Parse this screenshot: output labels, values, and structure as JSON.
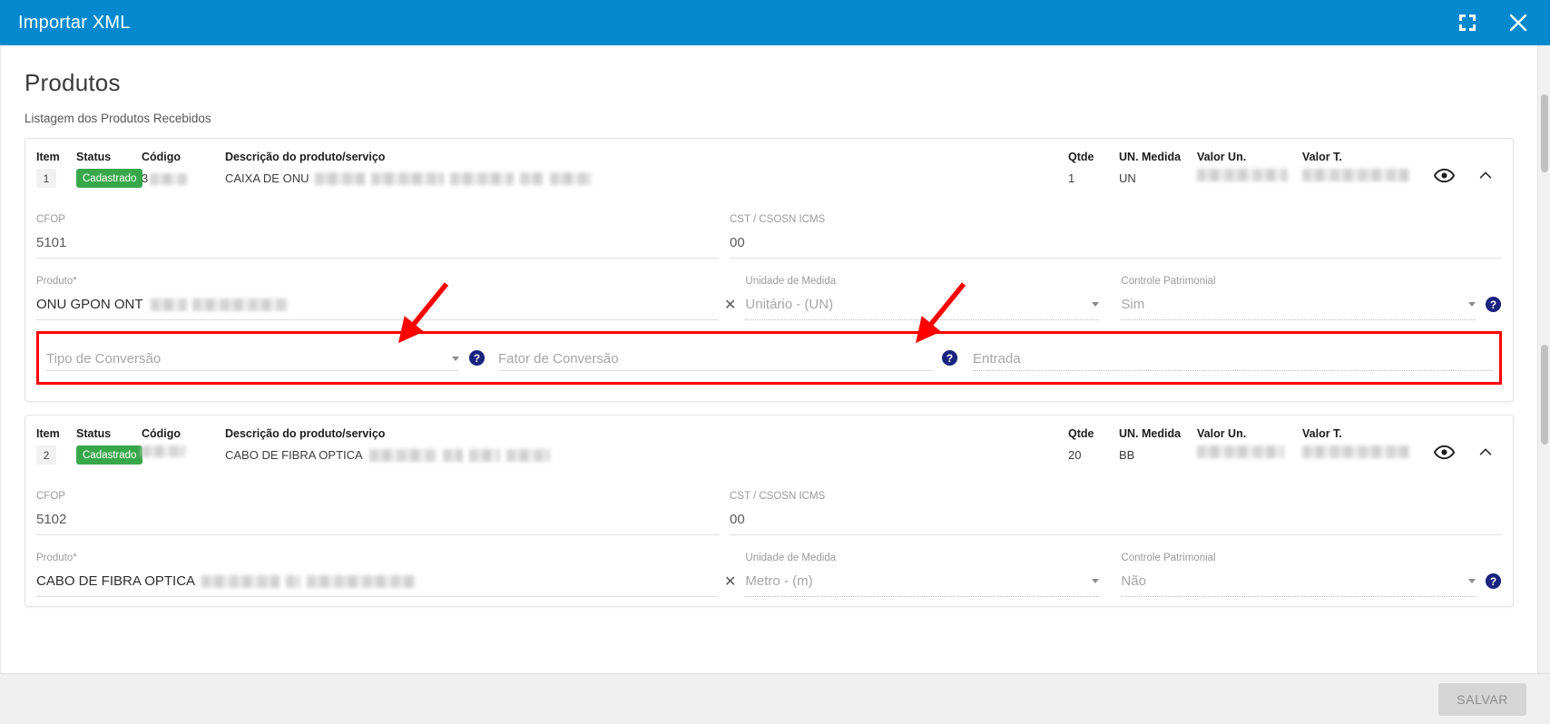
{
  "window": {
    "title": "Importar XML",
    "header_bg": "#0489cf",
    "maximize_icon": "expand-icon",
    "close_icon": "close-icon"
  },
  "page": {
    "title": "Produtos",
    "subtitle": "Listagem dos Produtos Recebidos"
  },
  "columns": {
    "item": "Item",
    "status": "Status",
    "codigo": "Código",
    "descricao": "Descrição do produto/serviço",
    "qtde": "Qtde",
    "un_medida": "UN. Medida",
    "valor_un": "Valor Un.",
    "valor_t": "Valor T."
  },
  "labels": {
    "cfop": "CFOP",
    "cst": "CST / CSOSN ICMS",
    "produto": "Produto",
    "produto_required_mark": "*",
    "unidade_medida": "Unidade de Medida",
    "controle_patrimonial": "Controle Patrimonial"
  },
  "placeholders": {
    "tipo_conversao": "Tipo de Conversão",
    "fator_conversao": "Fator de Conversão",
    "entrada": "Entrada"
  },
  "icons": {
    "eye": "eye-icon",
    "collapse": "chevron-up-icon",
    "help": "help-circle-icon",
    "clear": "clear-x-icon",
    "dropdown": "chevron-down-icon"
  },
  "products": [
    {
      "item": "1",
      "status": "Cadastrado",
      "codigo_redacted": true,
      "descricao": "CAIXA DE ONU",
      "qtde": "1",
      "un_medida": "UN",
      "valor_un_redacted": true,
      "valor_t_redacted": true,
      "cfop": "5101",
      "cst": "00",
      "produto": "ONU GPON ONT",
      "unidade_medida": "Unitário - (UN)",
      "controle_patrimonial": "Sim"
    },
    {
      "item": "2",
      "status": "Cadastrado",
      "codigo_redacted": true,
      "descricao": "CABO DE FIBRA OPTICA",
      "qtde": "20",
      "un_medida": "BB",
      "valor_un_redacted": true,
      "valor_t_redacted": true,
      "cfop": "5102",
      "cst": "00",
      "produto": "CABO DE FIBRA OPTICA",
      "unidade_medida": "Metro - (m)",
      "controle_patrimonial": "Não"
    }
  ],
  "footer": {
    "save_label": "SALVAR"
  },
  "annotations": {
    "highlight_color": "#ff0000",
    "arrow_count": 2
  }
}
